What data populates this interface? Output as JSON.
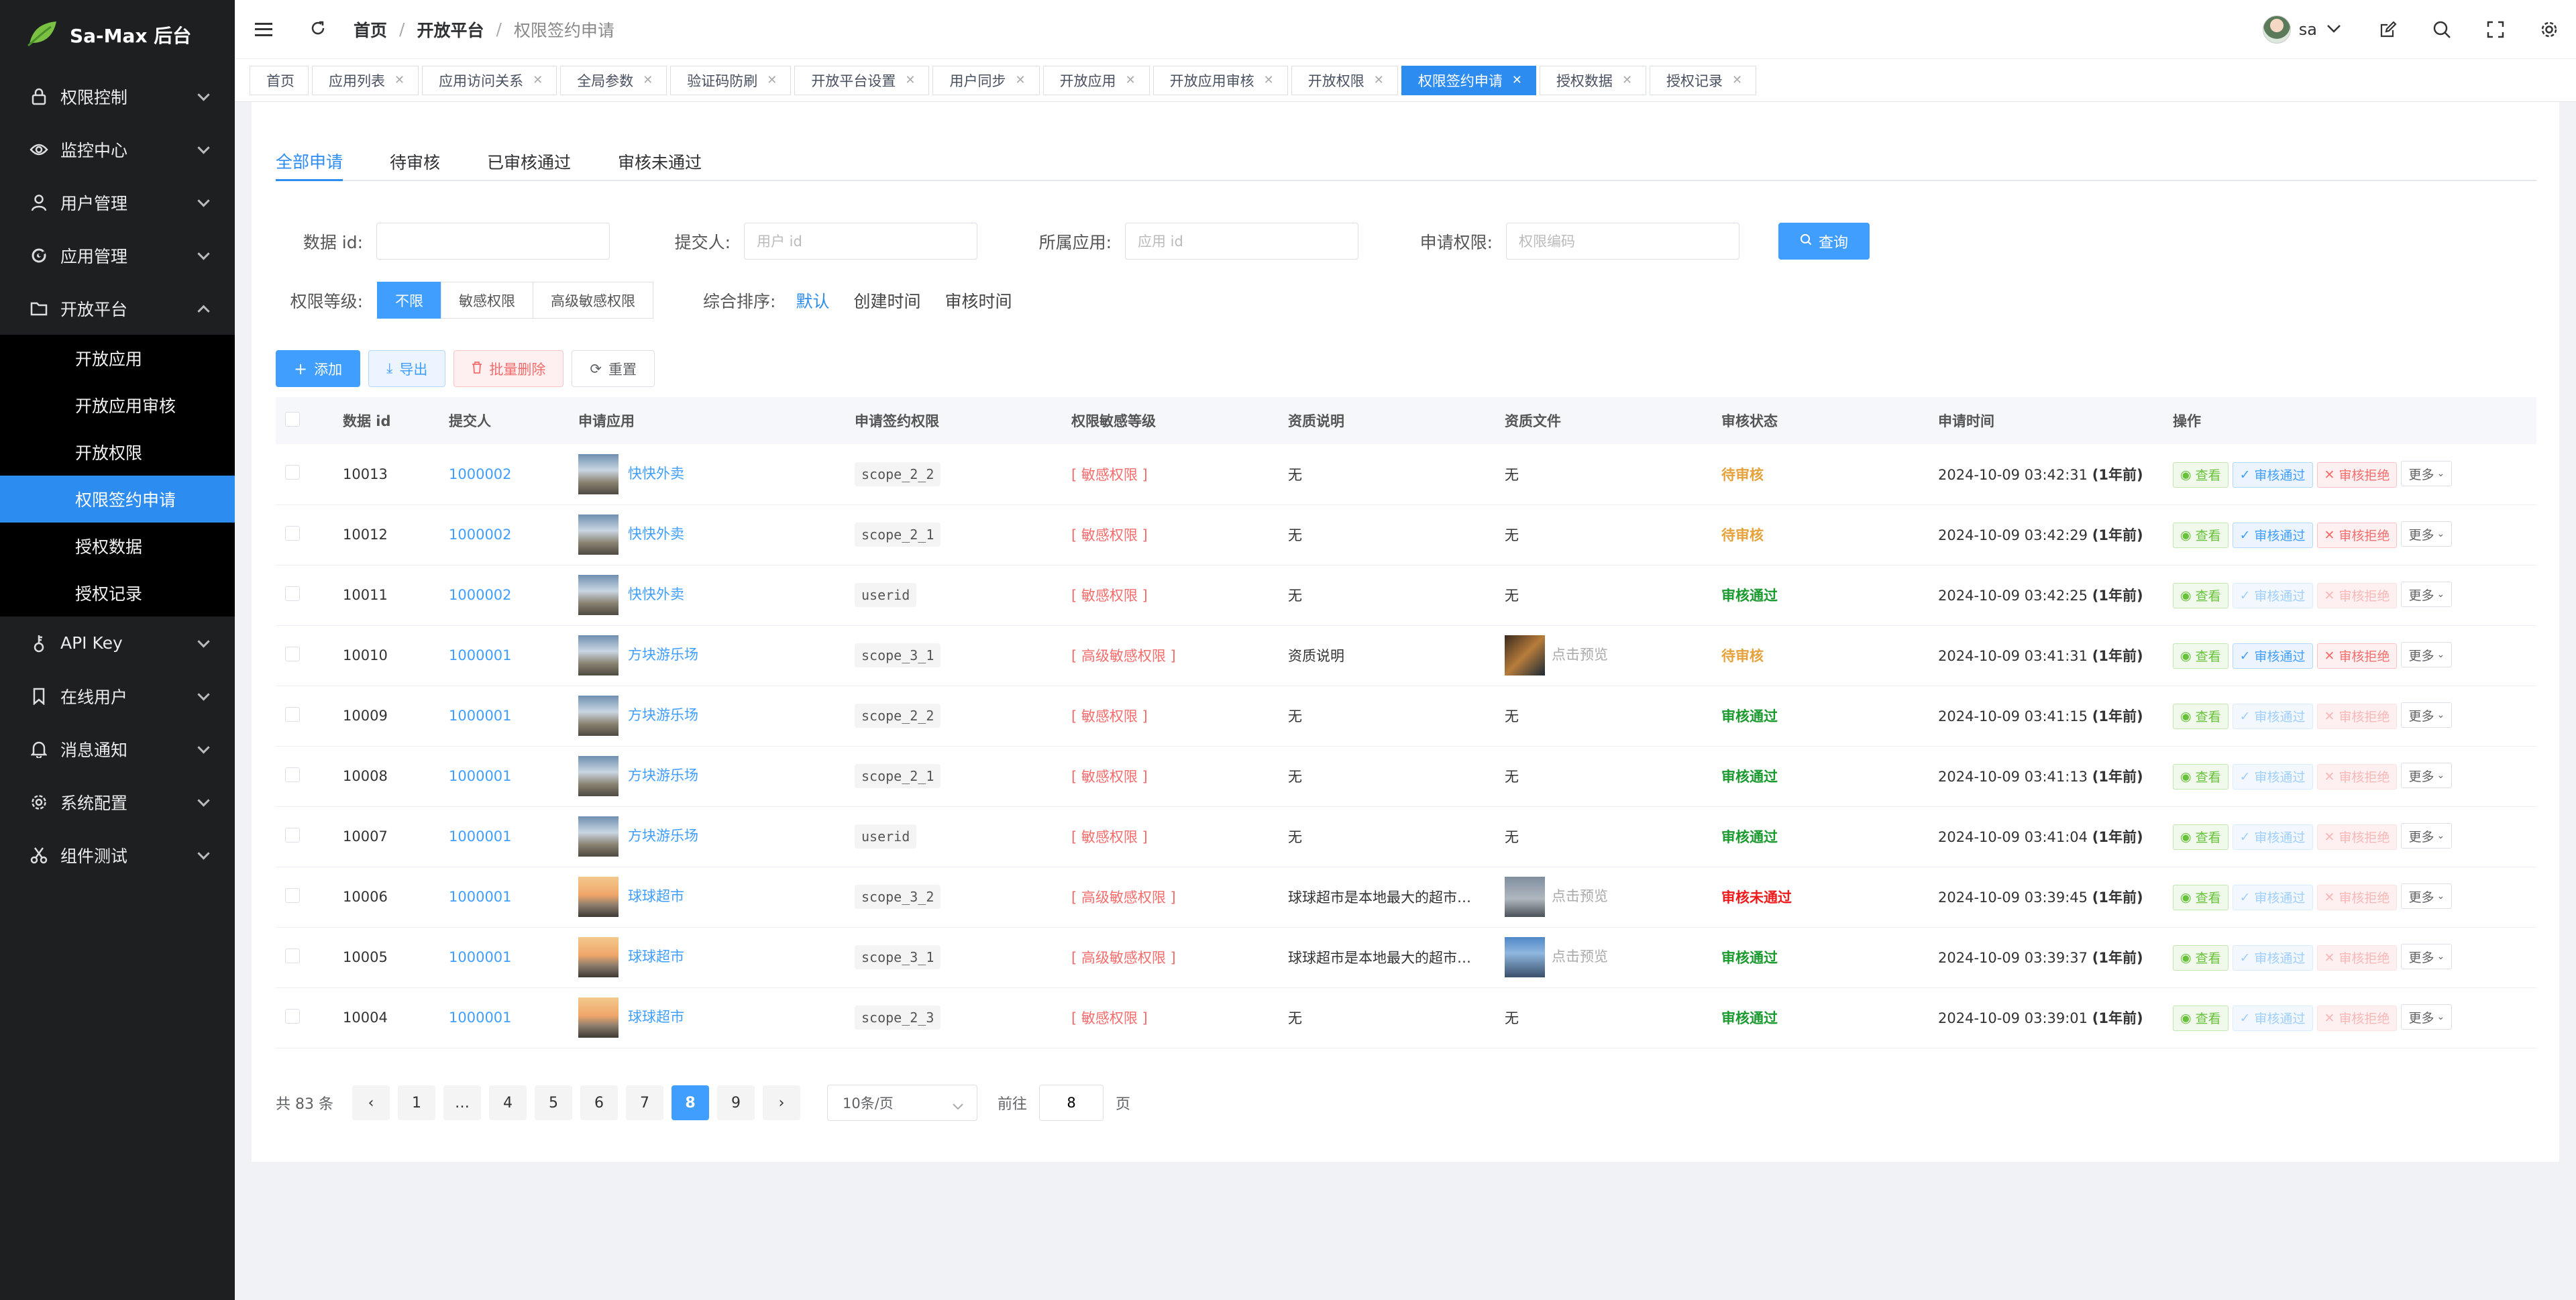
{
  "app": {
    "title": "Sa-Max 后台"
  },
  "sidebar": {
    "items": [
      {
        "label": "权限控制",
        "icon": "lock-icon"
      },
      {
        "label": "监控中心",
        "icon": "eye-icon"
      },
      {
        "label": "用户管理",
        "icon": "user-icon"
      },
      {
        "label": "应用管理",
        "icon": "app-icon"
      },
      {
        "label": "开放平台",
        "icon": "folder-icon",
        "expanded": true
      }
    ],
    "subitems": [
      "开放应用",
      "开放应用审核",
      "开放权限",
      "权限签约申请",
      "授权数据",
      "授权记录"
    ],
    "active_subitem": "权限签约申请",
    "items_after": [
      {
        "label": "API Key",
        "icon": "key-icon"
      },
      {
        "label": "在线用户",
        "icon": "bookmark-icon"
      },
      {
        "label": "消息通知",
        "icon": "bell-icon"
      },
      {
        "label": "系统配置",
        "icon": "gear-icon"
      },
      {
        "label": "组件测试",
        "icon": "scissors-icon"
      }
    ]
  },
  "header": {
    "breadcrumb": [
      "首页",
      "开放平台",
      "权限签约申请"
    ],
    "user": "sa"
  },
  "tabs": [
    "首页",
    "应用列表",
    "应用访问关系",
    "全局参数",
    "验证码防刷",
    "开放平台设置",
    "用户同步",
    "开放应用",
    "开放应用审核",
    "开放权限",
    "权限签约申请",
    "授权数据",
    "授权记录"
  ],
  "active_tab": "权限签约申请",
  "subtabs": [
    "全部申请",
    "待审核",
    "已审核通过",
    "审核未通过"
  ],
  "filters": {
    "data_id_label": "数据 id:",
    "submitter_label": "提交人:",
    "submitter_placeholder": "用户 id",
    "app_label": "所属应用:",
    "app_placeholder": "应用 id",
    "perm_label": "申请权限:",
    "perm_placeholder": "权限编码",
    "query_button": "查询",
    "level_label": "权限等级:",
    "levels": [
      "不限",
      "敏感权限",
      "高级敏感权限"
    ],
    "sort_label": "综合排序:",
    "sorts": [
      "默认",
      "创建时间",
      "审核时间"
    ]
  },
  "toolbar": {
    "add": "添加",
    "export": "导出",
    "batch_delete": "批量删除",
    "reset": "重置"
  },
  "table": {
    "headers": [
      "数据 id",
      "提交人",
      "申请应用",
      "申请签约权限",
      "权限敏感等级",
      "资质说明",
      "资质文件",
      "审核状态",
      "申请时间",
      "操作"
    ],
    "rows": [
      {
        "id": "10013",
        "submitter": "1000002",
        "app": "快快外卖",
        "scope": "scope_2_2",
        "level": "[ 敏感权限 ]",
        "desc": "无",
        "file": "无",
        "status": "待审核",
        "time": "2024-10-09 03:42:31",
        "rel": "(1年前)"
      },
      {
        "id": "10012",
        "submitter": "1000002",
        "app": "快快外卖",
        "scope": "scope_2_1",
        "level": "[ 敏感权限 ]",
        "desc": "无",
        "file": "无",
        "status": "待审核",
        "time": "2024-10-09 03:42:29",
        "rel": "(1年前)"
      },
      {
        "id": "10011",
        "submitter": "1000002",
        "app": "快快外卖",
        "scope": "userid",
        "level": "[ 敏感权限 ]",
        "desc": "无",
        "file": "无",
        "status": "审核通过",
        "time": "2024-10-09 03:42:25",
        "rel": "(1年前)"
      },
      {
        "id": "10010",
        "submitter": "1000001",
        "app": "方块游乐场",
        "scope": "scope_3_1",
        "level": "[ 高级敏感权限 ]",
        "desc": "资质说明",
        "file": "点击预览",
        "status": "待审核",
        "time": "2024-10-09 03:41:31",
        "rel": "(1年前)"
      },
      {
        "id": "10009",
        "submitter": "1000001",
        "app": "方块游乐场",
        "scope": "scope_2_2",
        "level": "[ 敏感权限 ]",
        "desc": "无",
        "file": "无",
        "status": "审核通过",
        "time": "2024-10-09 03:41:15",
        "rel": "(1年前)"
      },
      {
        "id": "10008",
        "submitter": "1000001",
        "app": "方块游乐场",
        "scope": "scope_2_1",
        "level": "[ 敏感权限 ]",
        "desc": "无",
        "file": "无",
        "status": "审核通过",
        "time": "2024-10-09 03:41:13",
        "rel": "(1年前)"
      },
      {
        "id": "10007",
        "submitter": "1000001",
        "app": "方块游乐场",
        "scope": "userid",
        "level": "[ 敏感权限 ]",
        "desc": "无",
        "file": "无",
        "status": "审核通过",
        "time": "2024-10-09 03:41:04",
        "rel": "(1年前)"
      },
      {
        "id": "10006",
        "submitter": "1000001",
        "app": "球球超市",
        "scope": "scope_3_2",
        "level": "[ 高级敏感权限 ]",
        "desc": "球球超市是本地最大的超市…",
        "file": "点击预览",
        "status": "审核未通过",
        "time": "2024-10-09 03:39:45",
        "rel": "(1年前)"
      },
      {
        "id": "10005",
        "submitter": "1000001",
        "app": "球球超市",
        "scope": "scope_3_1",
        "level": "[ 高级敏感权限 ]",
        "desc": "球球超市是本地最大的超市…",
        "file": "点击预览",
        "status": "审核通过",
        "time": "2024-10-09 03:39:37",
        "rel": "(1年前)"
      },
      {
        "id": "10004",
        "submitter": "1000001",
        "app": "球球超市",
        "scope": "scope_2_3",
        "level": "[ 敏感权限 ]",
        "desc": "无",
        "file": "无",
        "status": "审核通过",
        "time": "2024-10-09 03:39:01",
        "rel": "(1年前)"
      }
    ],
    "ops": {
      "view": "查看",
      "approve": "审核通过",
      "reject": "审核拒绝",
      "more": "更多"
    }
  },
  "pagination": {
    "total": "共 83 条",
    "pages": [
      "1",
      "…",
      "4",
      "5",
      "6",
      "7",
      "8",
      "9"
    ],
    "current": "8",
    "page_size": "10条/页",
    "goto_label": "前往",
    "goto_value": "8",
    "page_suffix": "页"
  },
  "colors": {
    "primary": "#409eff",
    "sidebar_bg": "#1e1f21",
    "active_menu": "#2d8cf0",
    "pending": "#e6a23c",
    "approved": "#1b9a2f",
    "rejected": "#ed1b1b"
  }
}
